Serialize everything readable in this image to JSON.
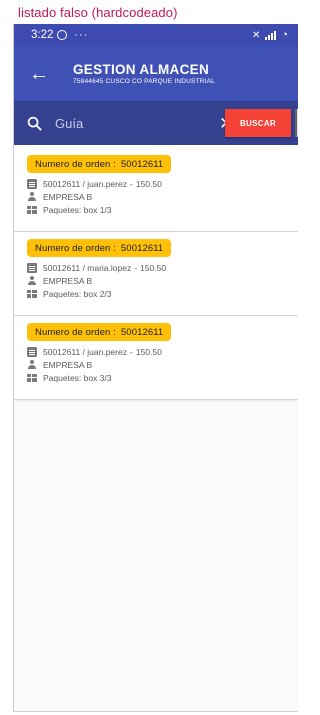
{
  "caption": "listado falso (hardcodeado)",
  "status_bar": {
    "time": "3:22",
    "more": "···",
    "signal": "4G"
  },
  "app_bar": {
    "title": "GESTION ALMACEN",
    "subtitle": "75844645 CUSCO CO PARQUE INDUSTRIAL"
  },
  "search": {
    "placeholder": "Guía",
    "value": "",
    "button_label": "BUSCAR"
  },
  "orders": [
    {
      "badge_label": "Numero de orden :",
      "order_number": "50012611",
      "line": "50012611 / juan.perez",
      "amount": "150.50",
      "company": "EMPRESA B",
      "packages": "Paquetes: box 1/3"
    },
    {
      "badge_label": "Numero de orden :",
      "order_number": "50012611",
      "line": "50012611 / maria.lopez",
      "amount": "150.50",
      "company": "EMPRESA B",
      "packages": "Paquetes: box 2/3"
    },
    {
      "badge_label": "Numero de orden :",
      "order_number": "50012611",
      "line": "50012611 / juan.perez",
      "amount": "150.50",
      "company": "EMPRESA B",
      "packages": "Paquetes: box 3/3"
    }
  ],
  "colors": {
    "app_bar": "#3f51b5",
    "search_bar": "#34418f",
    "buscar_button": "#f44336",
    "order_badge": "#ffc107",
    "caption": "#c2185b"
  }
}
